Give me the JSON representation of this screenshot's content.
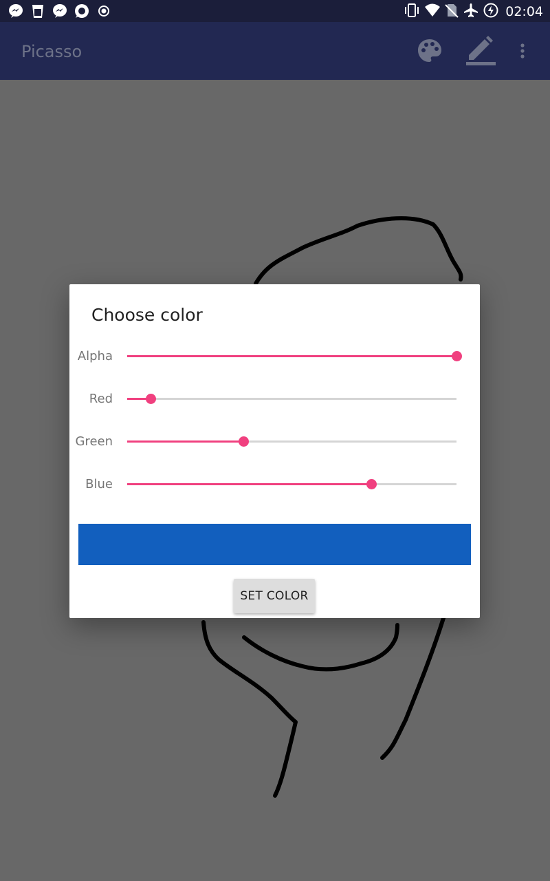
{
  "status_bar": {
    "time": "02:04",
    "notification_icons": [
      "messenger-icon",
      "cup-icon",
      "messenger-icon",
      "chat-icon",
      "record-icon"
    ],
    "system_icons": [
      "vibrate-icon",
      "wifi-icon",
      "no-sim-icon",
      "airplane-icon",
      "battery-charging-icon"
    ]
  },
  "appbar": {
    "title": "Picasso",
    "actions": [
      "palette-icon",
      "pencil-icon",
      "more-vert-icon"
    ]
  },
  "dialog": {
    "title": "Choose color",
    "sliders": [
      {
        "label": "Alpha",
        "value": 255,
        "max": 255
      },
      {
        "label": "Red",
        "value": 18,
        "max": 255
      },
      {
        "label": "Green",
        "value": 90,
        "max": 255
      },
      {
        "label": "Blue",
        "value": 189,
        "max": 255
      }
    ],
    "preview_color": "#125fbe",
    "button_label": "SET COLOR"
  },
  "colors": {
    "accent": "#f0407f",
    "appbar": "#222852",
    "statusbar": "#1b1e3a",
    "scrim": "#686868"
  }
}
